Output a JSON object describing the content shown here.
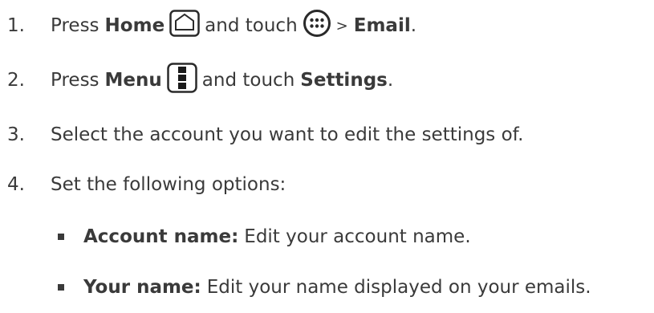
{
  "steps": [
    {
      "number": "1.",
      "text_a": "Press",
      "bold_a": "Home",
      "icon_a": "home-icon",
      "text_b": "and touch",
      "icon_b": "apps-icon",
      "text_c": ">",
      "bold_b": "Email",
      "text_d": "."
    },
    {
      "number": "2.",
      "text_a": "Press",
      "bold_a": "Menu",
      "icon_a": "menu-icon",
      "text_b": "and touch",
      "bold_b": "Settings",
      "text_c": "."
    },
    {
      "number": "3.",
      "text": "Select the account you want to edit the settings of."
    },
    {
      "number": "4.",
      "text": "Set the following options:"
    }
  ],
  "options": [
    {
      "label": "Account name:",
      "text": "Edit your account name."
    },
    {
      "label": "Your name:",
      "text": "Edit your name displayed on your emails."
    }
  ],
  "colors": {
    "text": "#3a3a3a"
  }
}
